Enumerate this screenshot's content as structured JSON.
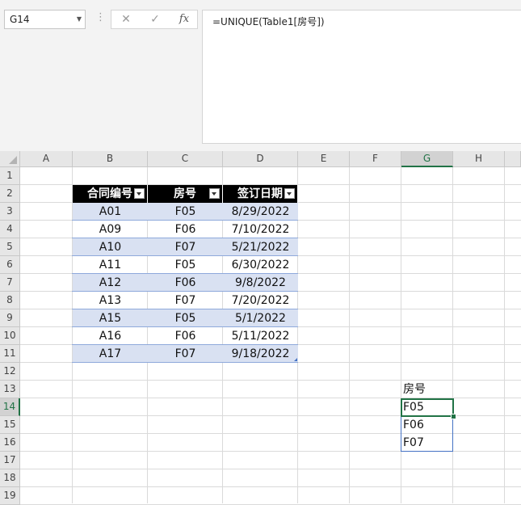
{
  "name_box": "G14",
  "formula_bar": {
    "cancel_glyph": "✕",
    "enter_glyph": "✓",
    "fx_label": "fx",
    "formula": "=UNIQUE(Table1[房号])"
  },
  "columns": [
    "A",
    "B",
    "C",
    "D",
    "E",
    "F",
    "G",
    "H"
  ],
  "rows": [
    "1",
    "2",
    "3",
    "4",
    "5",
    "6",
    "7",
    "8",
    "9",
    "10",
    "11",
    "12",
    "13",
    "14",
    "15",
    "16",
    "17",
    "18",
    "19"
  ],
  "selected_column": "G",
  "selected_row": "14",
  "table": {
    "headers": [
      "合同编号",
      "房号",
      "签订日期"
    ],
    "rows": [
      [
        "A01",
        "F05",
        "8/29/2022"
      ],
      [
        "A09",
        "F06",
        "7/10/2022"
      ],
      [
        "A10",
        "F07",
        "5/21/2022"
      ],
      [
        "A11",
        "F05",
        "6/30/2022"
      ],
      [
        "A12",
        "F06",
        "9/8/2022"
      ],
      [
        "A13",
        "F07",
        "7/20/2022"
      ],
      [
        "A15",
        "F05",
        "5/1/2022"
      ],
      [
        "A16",
        "F06",
        "5/11/2022"
      ],
      [
        "A17",
        "F07",
        "9/18/2022"
      ]
    ]
  },
  "spill": {
    "header": "房号",
    "values": [
      "F05",
      "F06",
      "F07"
    ]
  },
  "colors": {
    "header_bg": "#000000",
    "band": "#d9e1f2",
    "selection": "#217346",
    "spill_border": "#4472c4"
  }
}
